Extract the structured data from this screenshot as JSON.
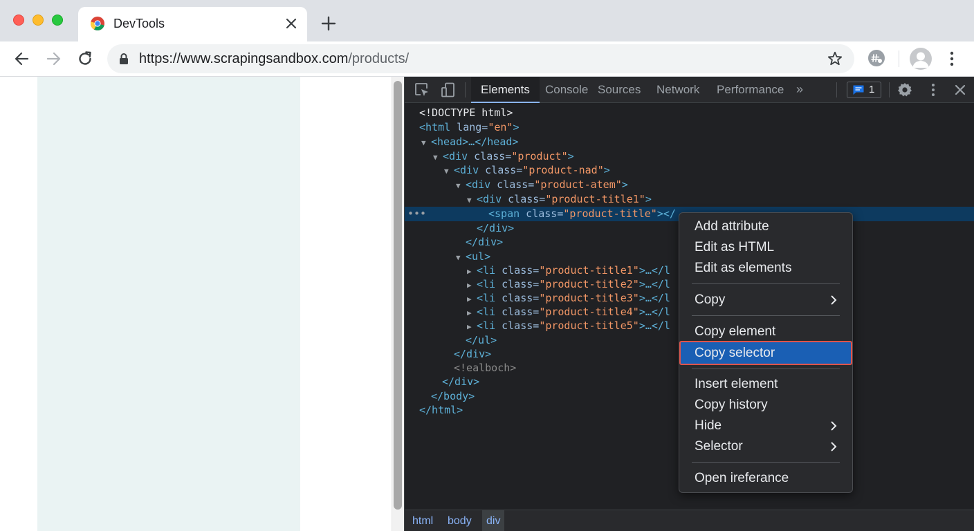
{
  "browser": {
    "tab_title": "DevTools",
    "url_host": "https://www.scrapingsandbox.com",
    "url_path": "/products/"
  },
  "devtools": {
    "tabs": [
      "Elements",
      "Console",
      "Sources",
      "Network",
      "Performance"
    ],
    "active_tab": "Elements",
    "more_tabs": "»",
    "issues_count": "1",
    "breadcrumbs": [
      "html",
      "body",
      "div"
    ],
    "code": {
      "doctype": "<!DOCTYPE html>",
      "html_open_tag": "<html",
      "html_lang_attr": " lang=",
      "html_lang_val": "\"en\"",
      "html_open_close": ">",
      "head": "<head>…</head>",
      "div": "<div",
      "class_attr": " class=",
      "gt": ">",
      "div_product": "\"product\"",
      "div_product_nad": "\"product-nad\"",
      "div_product_atem": "\"product-atem\"",
      "div_product_title1": "\"product-title1\"",
      "span_open": "<span",
      "span_class": "\"product-title\"",
      "span_close": "></",
      "close_div": "</div>",
      "ul_open": "<ul>",
      "li_open": "<li",
      "li_end": ">…</l",
      "li_classes": [
        "\"product-title1\"",
        "\"product-title2\"",
        "\"product-title3\"",
        "\"product-title4\"",
        "\"product-title5\""
      ],
      "ul_close": "</ul>",
      "comment": "<!ealboch>",
      "body_close": "</body>",
      "html_close": "</html>",
      "ellipsis": "•••"
    }
  },
  "context_menu": {
    "items": [
      {
        "label": "Add attribute"
      },
      {
        "label": "Edit as HTML"
      },
      {
        "label": "Edit as elements"
      },
      {
        "label": "Copy",
        "submenu": true
      },
      {
        "label": "Copy element"
      },
      {
        "label": "Copy selector",
        "highlighted": true
      },
      {
        "label": "Insert element"
      },
      {
        "label": "Copy history"
      },
      {
        "label": "Hide",
        "submenu": true
      },
      {
        "label": "Selector",
        "submenu": true
      },
      {
        "label": "Open ireferance"
      }
    ]
  },
  "colors": {
    "devtools_bg": "#202124",
    "selected_row": "#0d3a5f",
    "menu_highlight": "#1a5fb4",
    "highlight_outline": "#e0534a",
    "tag": "#5db0d7",
    "attr_value": "#f29766"
  }
}
